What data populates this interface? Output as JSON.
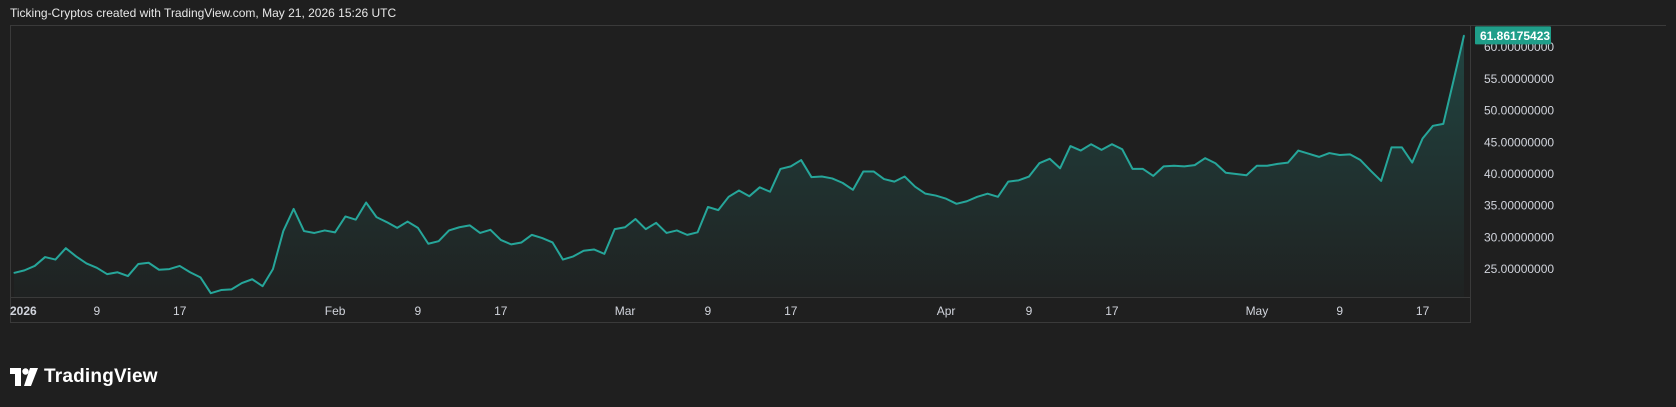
{
  "header": {
    "attribution": "Ticking-Cryptos created with TradingView.com, May 21, 2026 15:26 UTC"
  },
  "brand": {
    "name": "TradingView",
    "logo_icon": "tradingview-logo-icon"
  },
  "colors": {
    "line": "#26a69a",
    "background": "#1f1f1f",
    "grid_border": "#3a3a3a",
    "price_tag": "#1f9e89"
  },
  "chart_data": {
    "type": "area",
    "title": "",
    "xlabel": "",
    "ylabel": "",
    "x_range": [
      "2026-01-01",
      "2026-05-21"
    ],
    "ylim": [
      20.6,
      63.5
    ],
    "grid": false,
    "last_price_label": "61.86175423",
    "y_ticks": [
      {
        "value": 60,
        "label": "60.00000000"
      },
      {
        "value": 55,
        "label": "55.00000000"
      },
      {
        "value": 50,
        "label": "50.00000000"
      },
      {
        "value": 45,
        "label": "45.00000000"
      },
      {
        "value": 40,
        "label": "40.00000000"
      },
      {
        "value": 35,
        "label": "35.00000000"
      },
      {
        "value": 30,
        "label": "30.00000000"
      },
      {
        "value": 25,
        "label": "25.00000000"
      }
    ],
    "x_ticks": [
      {
        "date": "2026-01-01",
        "label": "2026",
        "bold": true
      },
      {
        "date": "2026-01-09",
        "label": "9"
      },
      {
        "date": "2026-01-17",
        "label": "17"
      },
      {
        "date": "2026-02-01",
        "label": "Feb"
      },
      {
        "date": "2026-02-09",
        "label": "9"
      },
      {
        "date": "2026-02-17",
        "label": "17"
      },
      {
        "date": "2026-03-01",
        "label": "Mar"
      },
      {
        "date": "2026-03-09",
        "label": "9"
      },
      {
        "date": "2026-03-17",
        "label": "17"
      },
      {
        "date": "2026-04-01",
        "label": "Apr"
      },
      {
        "date": "2026-04-09",
        "label": "9"
      },
      {
        "date": "2026-04-17",
        "label": "17"
      },
      {
        "date": "2026-05-01",
        "label": "May"
      },
      {
        "date": "2026-05-09",
        "label": "9"
      },
      {
        "date": "2026-05-17",
        "label": "17"
      }
    ],
    "series": [
      {
        "x": [
          "2026-01-01",
          "2026-01-02",
          "2026-01-03",
          "2026-01-04",
          "2026-01-05",
          "2026-01-06",
          "2026-01-07",
          "2026-01-08",
          "2026-01-09",
          "2026-01-10",
          "2026-01-11",
          "2026-01-12",
          "2026-01-13",
          "2026-01-14",
          "2026-01-15",
          "2026-01-16",
          "2026-01-17",
          "2026-01-18",
          "2026-01-19",
          "2026-01-20",
          "2026-01-21",
          "2026-01-22",
          "2026-01-23",
          "2026-01-24",
          "2026-01-25",
          "2026-01-26",
          "2026-01-27",
          "2026-01-28",
          "2026-01-29",
          "2026-01-30",
          "2026-01-31",
          "2026-02-01",
          "2026-02-02",
          "2026-02-03",
          "2026-02-04",
          "2026-02-05",
          "2026-02-06",
          "2026-02-07",
          "2026-02-08",
          "2026-02-09",
          "2026-02-10",
          "2026-02-11",
          "2026-02-12",
          "2026-02-13",
          "2026-02-14",
          "2026-02-15",
          "2026-02-16",
          "2026-02-17",
          "2026-02-18",
          "2026-02-19",
          "2026-02-20",
          "2026-02-21",
          "2026-02-22",
          "2026-02-23",
          "2026-02-24",
          "2026-02-25",
          "2026-02-26",
          "2026-02-27",
          "2026-02-28",
          "2026-03-01",
          "2026-03-02",
          "2026-03-03",
          "2026-03-04",
          "2026-03-05",
          "2026-03-06",
          "2026-03-07",
          "2026-03-08",
          "2026-03-09",
          "2026-03-10",
          "2026-03-11",
          "2026-03-12",
          "2026-03-13",
          "2026-03-14",
          "2026-03-15",
          "2026-03-16",
          "2026-03-17",
          "2026-03-18",
          "2026-03-19",
          "2026-03-20",
          "2026-03-21",
          "2026-03-22",
          "2026-03-23",
          "2026-03-24",
          "2026-03-25",
          "2026-03-26",
          "2026-03-27",
          "2026-03-28",
          "2026-03-29",
          "2026-03-30",
          "2026-03-31",
          "2026-04-01",
          "2026-04-02",
          "2026-04-03",
          "2026-04-04",
          "2026-04-05",
          "2026-04-06",
          "2026-04-07",
          "2026-04-08",
          "2026-04-09",
          "2026-04-10",
          "2026-04-11",
          "2026-04-12",
          "2026-04-13",
          "2026-04-14",
          "2026-04-15",
          "2026-04-16",
          "2026-04-17",
          "2026-04-18",
          "2026-04-19",
          "2026-04-20",
          "2026-04-21",
          "2026-04-22",
          "2026-04-23",
          "2026-04-24",
          "2026-04-25",
          "2026-04-26",
          "2026-04-27",
          "2026-04-28",
          "2026-04-29",
          "2026-04-30",
          "2026-05-01",
          "2026-05-02",
          "2026-05-03",
          "2026-05-04",
          "2026-05-05",
          "2026-05-06",
          "2026-05-07",
          "2026-05-08",
          "2026-05-09",
          "2026-05-10",
          "2026-05-11",
          "2026-05-12",
          "2026-05-13",
          "2026-05-14",
          "2026-05-15",
          "2026-05-16",
          "2026-05-17",
          "2026-05-18",
          "2026-05-19",
          "2026-05-20",
          "2026-05-21"
        ],
        "values": [
          24.4,
          24.8,
          25.5,
          26.9,
          26.5,
          28.3,
          27.0,
          25.9,
          25.2,
          24.2,
          24.5,
          23.9,
          25.8,
          26.0,
          24.9,
          25.0,
          25.5,
          24.5,
          23.7,
          21.2,
          21.7,
          21.8,
          22.8,
          23.4,
          22.3,
          25.0,
          31.0,
          34.5,
          31.0,
          30.7,
          31.1,
          30.8,
          33.3,
          32.8,
          35.5,
          33.2,
          32.4,
          31.5,
          32.5,
          31.5,
          29.0,
          29.4,
          31.1,
          31.6,
          31.9,
          30.7,
          31.2,
          29.6,
          28.9,
          29.2,
          30.4,
          29.9,
          29.2,
          26.5,
          27.0,
          27.9,
          28.1,
          27.4,
          31.3,
          31.6,
          32.9,
          31.3,
          32.3,
          30.7,
          31.1,
          30.4,
          30.8,
          34.8,
          34.3,
          36.4,
          37.4,
          36.5,
          37.9,
          37.2,
          40.8,
          41.2,
          42.2,
          39.5,
          39.6,
          39.3,
          38.6,
          37.5,
          40.4,
          40.4,
          39.2,
          38.8,
          39.6,
          38.0,
          36.9,
          36.6,
          36.1,
          35.3,
          35.7,
          36.4,
          36.9,
          36.4,
          38.8,
          39.0,
          39.6,
          41.7,
          42.4,
          40.9,
          44.4,
          43.7,
          44.7,
          43.8,
          44.7,
          43.9,
          40.8,
          40.8,
          39.7,
          41.2,
          41.3,
          41.2,
          41.4,
          42.5,
          41.7,
          40.2,
          40.0,
          39.8,
          41.3,
          41.3,
          41.6,
          41.8,
          43.7,
          43.2,
          42.7,
          43.3,
          43.0,
          43.1,
          42.2,
          40.5,
          38.9,
          44.2,
          44.2,
          41.8,
          45.6,
          47.6,
          47.9,
          54.8,
          61.86
        ]
      }
    ]
  }
}
